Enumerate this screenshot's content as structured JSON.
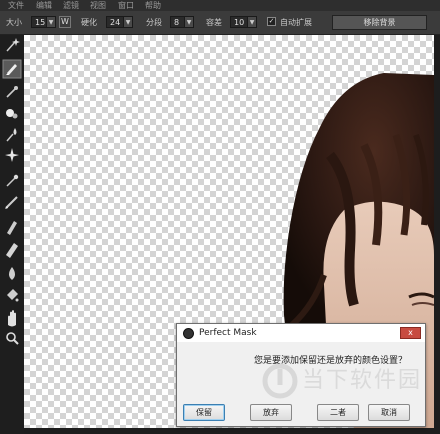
{
  "menu": {
    "items": [
      "文件",
      "编辑",
      "滤镜",
      "视图",
      "窗口",
      "帮助"
    ]
  },
  "options": {
    "size_label": "大小",
    "size_value": "15",
    "w_label": "W",
    "feather_label": "硬化",
    "feather_value": "24",
    "segments_label": "分段",
    "segments_value": "8",
    "gap_label": "容差",
    "gap_value": "10",
    "auto_expand_label": "自动扩展",
    "auto_expand_checked": true,
    "reset_label": "移除背景"
  },
  "toolbar": {
    "tools": [
      "magic-wand-icon",
      "brush-keep-icon",
      "eyedropper-icon",
      "brush-remove-icon",
      "drop-icon",
      "sparkle-icon",
      "magic-brush-icon",
      "pen-icon",
      "chisel-icon",
      "eraser-icon",
      "blur-icon",
      "bucket-icon",
      "hand-icon",
      "zoom-icon"
    ]
  },
  "dialog": {
    "title": "Perfect Mask",
    "close": "x",
    "message": "您是要添加保留还是放弃的颜色设置？",
    "buttons": {
      "keep": "保留",
      "discard": "放弃",
      "both": "二者",
      "cancel": "取消"
    }
  },
  "watermark": {
    "text": "当下软件园"
  },
  "colors": {
    "dialog_close": "#c74b40",
    "panel": "#3b3b3b",
    "toolbar": "#1e1e1e"
  }
}
